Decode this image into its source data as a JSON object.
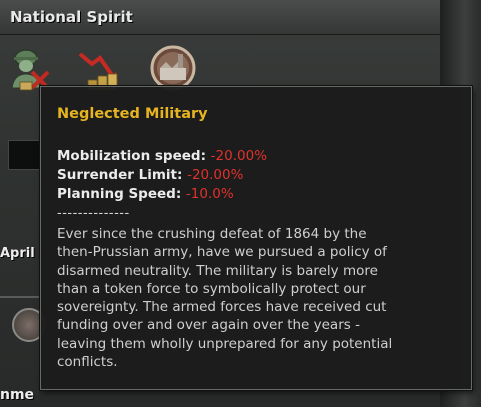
{
  "header": {
    "title": "National Spirit"
  },
  "side": {
    "date_fragment": "April",
    "bottom_fragment": "nme"
  },
  "spirits": [
    {
      "icon": "soldier-helmet-icon"
    },
    {
      "icon": "declining-economy-icon"
    },
    {
      "icon": "industry-factory-icon"
    }
  ],
  "tooltip": {
    "title": "Neglected Military",
    "modifiers": [
      {
        "label": "Mobilization speed:",
        "value": "-20.00%"
      },
      {
        "label": "Surrender Limit:",
        "value": "-20.00%"
      },
      {
        "label": "Planning Speed:",
        "value": "-10.0%"
      }
    ],
    "separator": "--------------",
    "description_lines": [
      "Ever since the crushing defeat of 1864 by the",
      "then-Prussian army, have we pursued a policy of",
      "disarmed neutrality. The military is barely more",
      "than a token force to symbolically protect our",
      "sovereignty. The armed forces have received cut",
      "funding over and over again over the years -",
      "leaving them wholly unprepared for any potential",
      "conflicts."
    ]
  },
  "colors": {
    "title_gold": "#e6b420",
    "negative_red": "#e0322d",
    "text_light": "#ececec"
  }
}
